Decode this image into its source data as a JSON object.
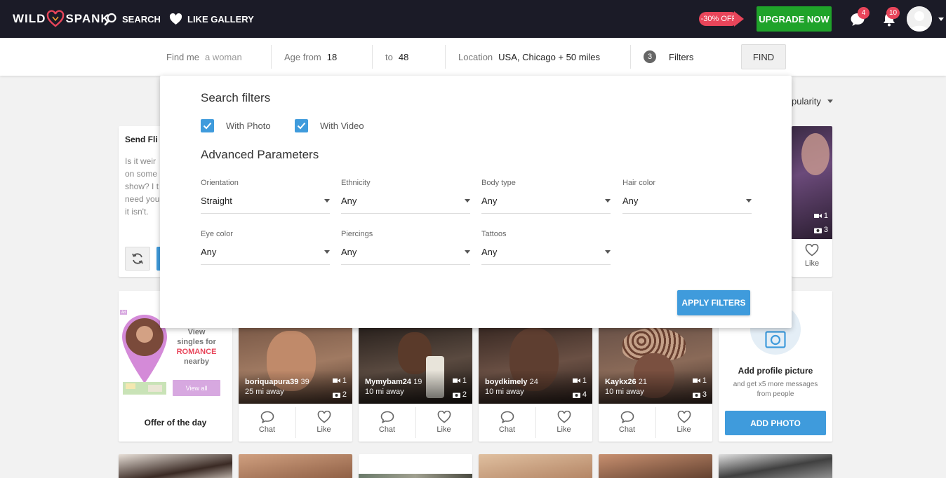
{
  "header": {
    "logo": {
      "left": "WILD",
      "right": "SPANK"
    },
    "nav": [
      {
        "label": "SEARCH",
        "icon": "search-icon"
      },
      {
        "label": "LIKE GALLERY",
        "icon": "heart-icon"
      }
    ],
    "promo": "-30% OFF",
    "upgrade_label": "UPGRADE NOW",
    "messages_count": "4",
    "notifications_count": "10"
  },
  "search": {
    "find_me_label": "Find me",
    "find_me_value": "a woman",
    "age_from_label": "Age from",
    "age_from_value": "18",
    "age_to_label": "to",
    "age_to_value": "48",
    "location_label": "Location",
    "location_value": "USA, Chicago + 50 miles",
    "filters_count": "3",
    "filters_label": "Filters",
    "find_label": "FIND"
  },
  "sort_value": "pularity",
  "flirt": {
    "title": "Send Fli",
    "lines": [
      "Is it weir",
      "on some",
      "show? I t",
      "need you",
      "it isn't."
    ]
  },
  "ad": {
    "tag": "Ad",
    "line1": "View",
    "line2": "singles for",
    "highlight": "ROMANCE",
    "line3": "nearby",
    "view_all": "View all",
    "offer": "Offer of the day"
  },
  "profiles": [
    {
      "name": "boriquapura39",
      "age": "39",
      "distance": "25 mi away",
      "videos": "1",
      "photos": "2",
      "chat": "Chat",
      "like": "Like"
    },
    {
      "name": "Mymybam24",
      "age": "19",
      "distance": "10 mi away",
      "videos": "1",
      "photos": "2",
      "chat": "Chat",
      "like": "Like"
    },
    {
      "name": "boydkimely",
      "age": "24",
      "distance": "10 mi away",
      "videos": "1",
      "photos": "4",
      "chat": "Chat",
      "like": "Like"
    },
    {
      "name": "Kaykx26",
      "age": "21",
      "distance": "10 mi away",
      "videos": "1",
      "photos": "3",
      "chat": "Chat",
      "like": "Like"
    }
  ],
  "top_right_card": {
    "videos": "1",
    "photos": "3",
    "like": "Like"
  },
  "add_photo": {
    "title": "Add profile picture",
    "subtitle_1": "and get x5 more messages",
    "subtitle_2": "from people",
    "button": "ADD PHOTO"
  },
  "filters_panel": {
    "title": "Search filters",
    "with_photo": "With Photo",
    "with_video": "With Video",
    "advanced_title": "Advanced Parameters",
    "fields": [
      {
        "label": "Orientation",
        "value": "Straight"
      },
      {
        "label": "Ethnicity",
        "value": "Any"
      },
      {
        "label": "Body type",
        "value": "Any"
      },
      {
        "label": "Hair color",
        "value": "Any"
      },
      {
        "label": "Eye color",
        "value": "Any"
      },
      {
        "label": "Piercings",
        "value": "Any"
      },
      {
        "label": "Tattoos",
        "value": "Any"
      }
    ],
    "apply": "APPLY FILTERS"
  },
  "colors": {
    "brand_dark": "#1b1b27",
    "accent_blue": "#3f9bdc",
    "upgrade_green": "#1fa32a",
    "badge_red": "#e8455a"
  }
}
